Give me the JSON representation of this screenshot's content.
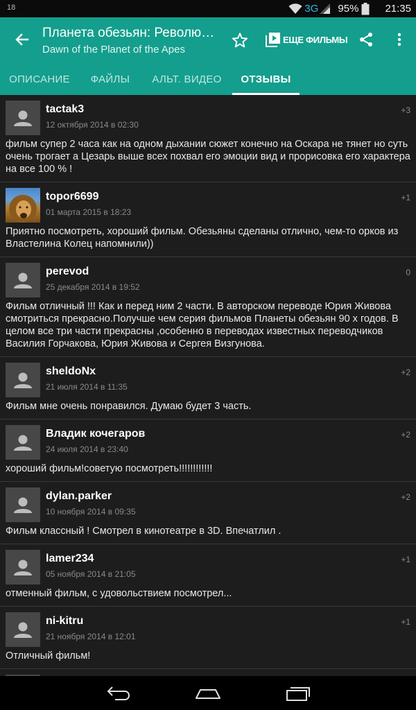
{
  "status_bar": {
    "notification": "18",
    "network": "3G",
    "battery": "95%",
    "time": "21:35",
    "icons": [
      "wifi-icon",
      "signal-icon",
      "battery-icon"
    ]
  },
  "app_bar": {
    "title": "Планета обезьян: Революция",
    "subtitle": "Dawn of the Planet of the Apes",
    "more_movies_label": "ЕЩЕ ФИЛЬМЫ",
    "accent_color": "#149e8d"
  },
  "tabs": [
    {
      "label": "ОПИСАНИЕ",
      "active": false
    },
    {
      "label": "ФАЙЛЫ",
      "active": false
    },
    {
      "label": "АЛЬТ. ВИДЕО",
      "active": false
    },
    {
      "label": "ОТЗЫВЫ",
      "active": true
    }
  ],
  "reviews": [
    {
      "author": "tactak3",
      "date": "12 октября 2014 в 02:30",
      "rating": "+3",
      "avatar": "default",
      "text": "фильм супер 2 часа как на одном дыхании сюжет конечно на Оскара не тянет но суть очень трогает а Цезарь выше всех похвал его эмоции вид и прорисовка его характера на все 100 % !"
    },
    {
      "author": "topor6699",
      "date": "01 марта 2015 в 18:23",
      "rating": "+1",
      "avatar": "lion-photo",
      "text": "Приятно посмотреть, хороший фильм. Обезьяны сделаны отлично, чем-то орков из Властелина Колец напомнили))"
    },
    {
      "author": "perevod",
      "date": "25 декабря 2014 в 19:52",
      "rating": "0",
      "avatar": "default",
      "text": "Фильм отличный !!! Как и перед ним 2 части. В авторском переводе Юрия Живова смотриться прекрасно.Получше чем серия фильмов Планеты обезьян 90 х годов. В целом все три части прекрасны ,особенно в переводах известных переводчиков Василия Горчакова, Юрия Живова и Сергея Визгунова."
    },
    {
      "author": "sheldoNx",
      "date": "21 июля 2014 в 11:35",
      "rating": "+2",
      "avatar": "default",
      "text": "Фильм мне очень понравился. Думаю будет 3 часть."
    },
    {
      "author": "Владик кочегаров",
      "date": "24 июля 2014 в 23:40",
      "rating": "+2",
      "avatar": "default",
      "text": "хороший фильм!советую посмотреть!!!!!!!!!!!!"
    },
    {
      "author": "dylan.parker",
      "date": "10 ноября 2014 в 09:35",
      "rating": "+2",
      "avatar": "default",
      "text": "Фильм классный ! Смотрел в кинотеатре в 3D. Впечатлил ."
    },
    {
      "author": "lamer234",
      "date": "05 ноября 2014 в 21:05",
      "rating": "+1",
      "avatar": "default",
      "text": "отменный фильм, с удовольствием посмотрел..."
    },
    {
      "author": "ni-kitru",
      "date": "21 ноября 2014 в 12:01",
      "rating": "+1",
      "avatar": "default",
      "text": "Отличный фильм!"
    }
  ],
  "nav_bar": {
    "icons": [
      "back-icon",
      "home-icon",
      "recents-icon"
    ]
  }
}
